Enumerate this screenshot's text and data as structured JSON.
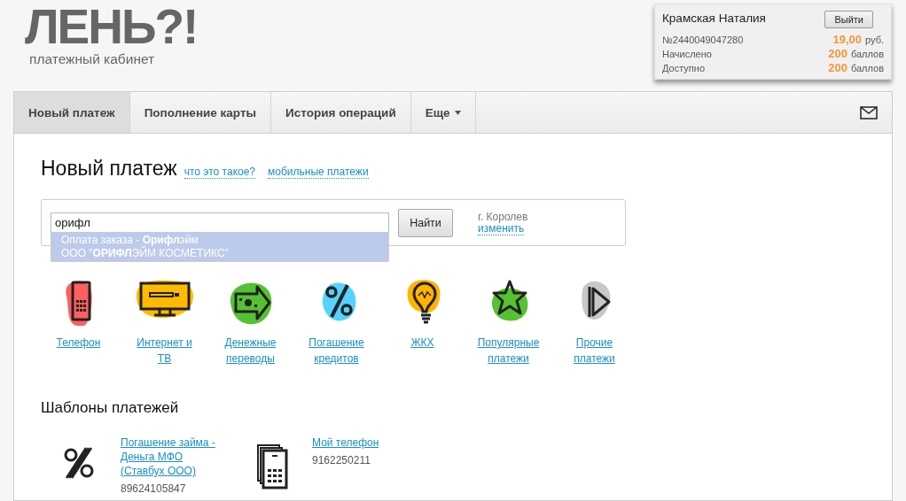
{
  "logo": {
    "title": "ЛЕНЬ?!",
    "subtitle": "платежный кабинет"
  },
  "account": {
    "name": "Крамская Наталия",
    "logout": "Выйти",
    "number": "№2440049047280",
    "balance": "19,00",
    "balance_unit": "руб.",
    "rows": [
      {
        "label": "Начислено",
        "value": "200",
        "unit": "баллов"
      },
      {
        "label": "Доступно",
        "value": "200",
        "unit": "баллов"
      }
    ]
  },
  "nav": {
    "tabs": [
      {
        "label": "Новый платеж",
        "selected": true,
        "kind": "plain"
      },
      {
        "label": "Пополнение карты",
        "selected": false,
        "kind": "plain"
      },
      {
        "label": "История операций",
        "selected": false,
        "kind": "plain"
      },
      {
        "label": "Еще",
        "selected": false,
        "kind": "menu"
      }
    ]
  },
  "page": {
    "title": "Новый платеж",
    "links": [
      "что это такое?",
      "мобильные платежи"
    ]
  },
  "search": {
    "value": "орифл",
    "button": "Найти",
    "city": "г. Королев",
    "change": "изменить",
    "suggestions": [
      {
        "line1": "Оплата заказа - **Орифл**эйм",
        "line2": "ООО \"**ОРИФЛ**ЭЙМ КОСМЕТИКС\"",
        "selected": true
      }
    ]
  },
  "categories": [
    {
      "kind": "phone",
      "color": "#ff5f5f",
      "label": "Телефон"
    },
    {
      "kind": "tv",
      "color": "#ffbb00",
      "label": "Интернет и ТВ"
    },
    {
      "kind": "money",
      "color": "#55c233",
      "label": "Денежные переводы"
    },
    {
      "kind": "percent",
      "color": "#55d2ff",
      "label": "Погашение кредитов"
    },
    {
      "kind": "bulb",
      "color": "#ffb400",
      "label": "ЖКХ"
    },
    {
      "kind": "star",
      "color": "#55c233",
      "label": "Популярные платежи"
    },
    {
      "kind": "play",
      "color": "#c8c8c8",
      "label": "Прочие платежи"
    }
  ],
  "templates": {
    "title": "Шаблоны платежей",
    "items": [
      {
        "kind": "percent",
        "name": "Погашение займа - Деньга МФО (Ставбух ООО)",
        "number": "89624105847"
      },
      {
        "kind": "phone",
        "name": "Мой телефон",
        "number": "9162250211"
      }
    ]
  }
}
